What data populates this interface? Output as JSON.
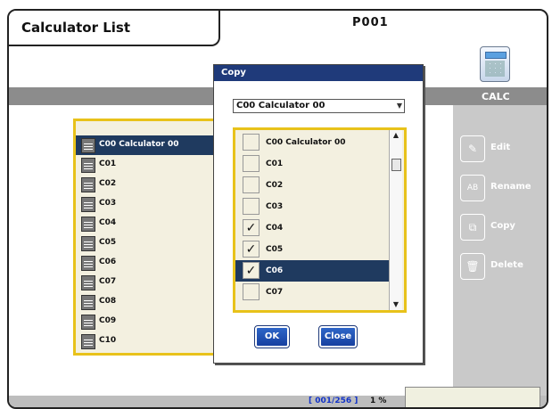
{
  "header": {
    "title": "Calculator List",
    "page_code": "P001",
    "band_label": "CALC",
    "calculator_icon": "calculator-icon"
  },
  "actions": [
    {
      "label": "Edit",
      "icon": "edit-icon"
    },
    {
      "label": "Rename",
      "icon": "rename-icon"
    },
    {
      "label": "Copy",
      "icon": "copy-icon"
    },
    {
      "label": "Delete",
      "icon": "trash-icon"
    }
  ],
  "calculator_list": {
    "items": [
      {
        "label": "C00 Calculator 00",
        "selected": true
      },
      {
        "label": "C01"
      },
      {
        "label": "C02"
      },
      {
        "label": "C03"
      },
      {
        "label": "C04"
      },
      {
        "label": "C05"
      },
      {
        "label": "C06"
      },
      {
        "label": "C07"
      },
      {
        "label": "C08"
      },
      {
        "label": "C09"
      },
      {
        "label": "C10"
      }
    ]
  },
  "copy_dialog": {
    "title": "Copy",
    "source_value": "C00 Calculator 00",
    "targets": [
      {
        "label": "C00 Calculator 00",
        "checked": false
      },
      {
        "label": "C01",
        "checked": false
      },
      {
        "label": "C02",
        "checked": false
      },
      {
        "label": "C03",
        "checked": false
      },
      {
        "label": "C04",
        "checked": true
      },
      {
        "label": "C05",
        "checked": true
      },
      {
        "label": "C06",
        "checked": true,
        "selected": true
      },
      {
        "label": "C07",
        "checked": false
      }
    ],
    "check_mark": "✓",
    "ok_label": "OK",
    "close_label": "Close"
  },
  "status": {
    "counter": "[ 001/256 ]",
    "percent": "1 %"
  },
  "colors": {
    "highlight": "#1f3a5f",
    "panel_border": "#e8c21a",
    "dialog_title": "#1f3a7a",
    "counter_text": "#1233c8"
  }
}
